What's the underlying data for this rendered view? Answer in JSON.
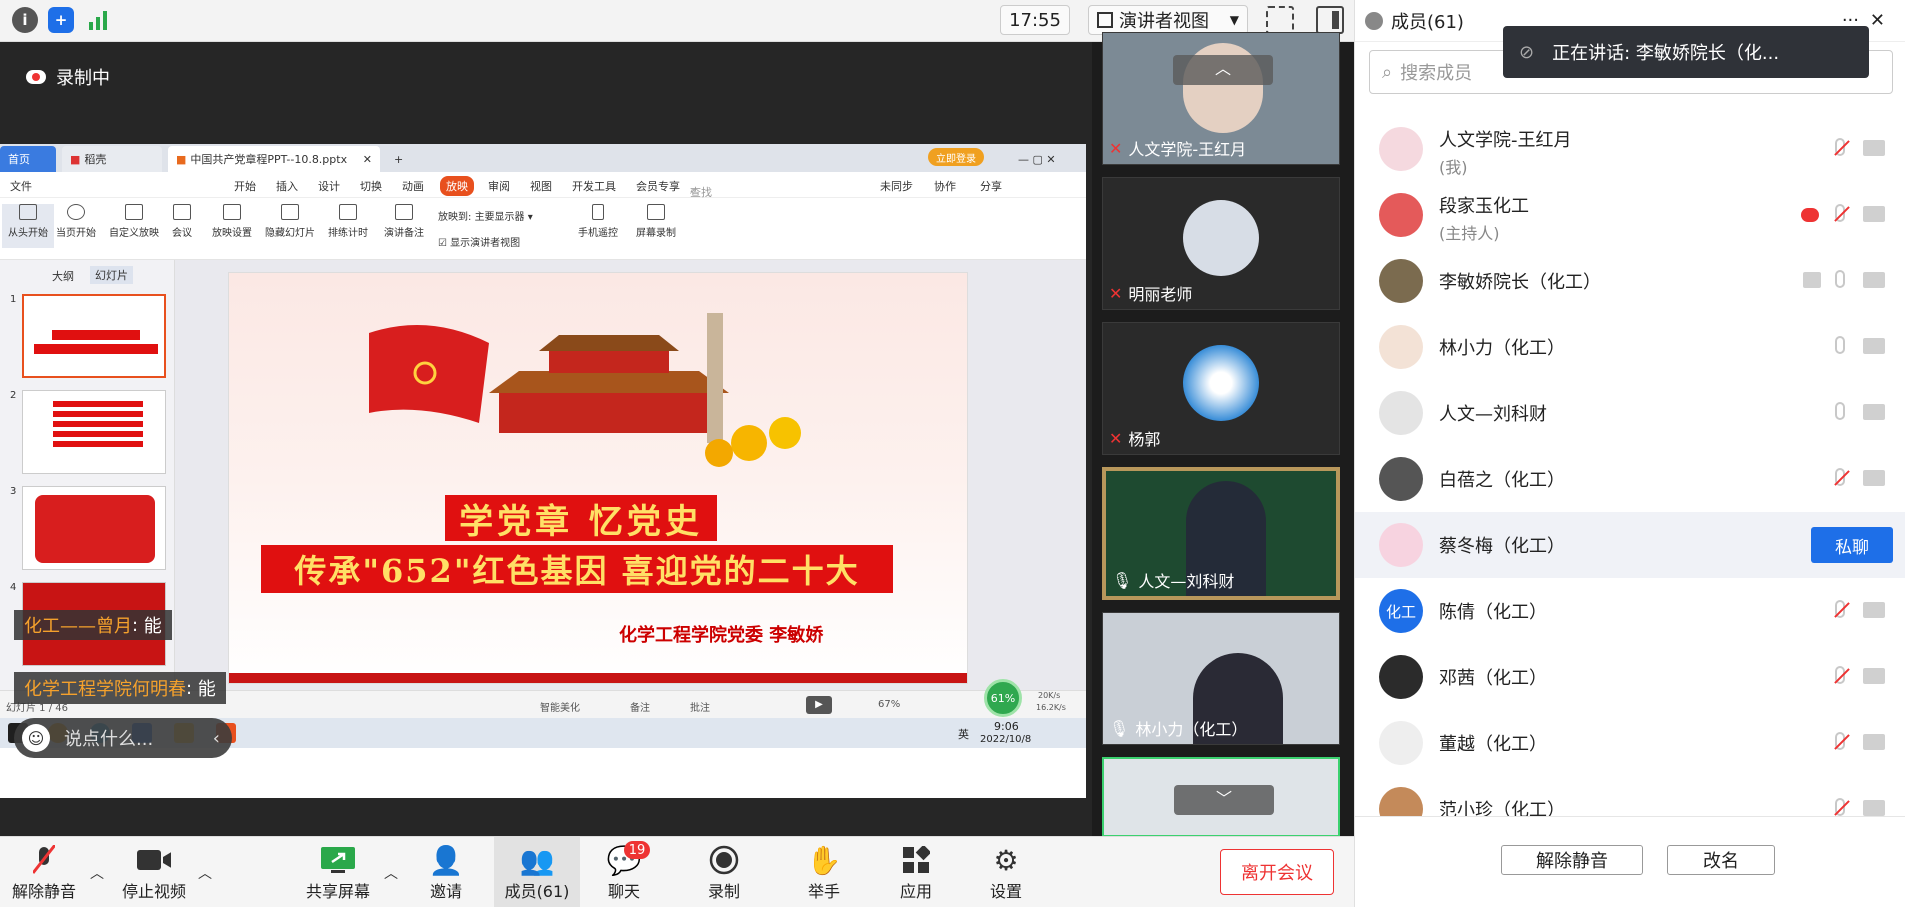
{
  "topbar": {
    "clock": "17:55",
    "view_mode": "演讲者视图"
  },
  "share": {
    "recording": "录制中",
    "wps": {
      "tabs": [
        "首页",
        "稻壳",
        "中国共产党章程PPT--10.8.pptx"
      ],
      "login": "立即登录",
      "menu": [
        "文件",
        "开始",
        "插入",
        "设计",
        "切换",
        "动画",
        "放映",
        "审阅",
        "视图",
        "开发工具",
        "会员专享"
      ],
      "search": "查找命令、搜索模板",
      "right_menu": [
        "未同步",
        "协作",
        "分享"
      ],
      "ribbon": [
        "从头开始",
        "当页开始",
        "自定义放映",
        "会议",
        "放映设置",
        "隐藏幻灯片",
        "排练计时",
        "演讲备注",
        "手机遥控",
        "屏幕录制"
      ],
      "display_label": "放映到:",
      "display_value": "主要显示器",
      "presenter_view": "显示演讲者视图",
      "pane_tabs": [
        "大纲",
        "幻灯片"
      ],
      "thumb_numbers": [
        "1",
        "2",
        "3",
        "4"
      ],
      "slide_title1": "学党章  忆党史",
      "slide_title2": "传承\"652\"红色基因  喜迎党的二十大",
      "slide_author": "化学工程学院党委  李敏娇",
      "status_left": "幻灯片 1 / 46",
      "status_right": [
        "智能美化",
        "备注",
        "批注"
      ],
      "zoom": "67%",
      "net_percent": "61%",
      "net_up": "20K/s",
      "net_down": "16.2K/s",
      "task_time": "9:06",
      "task_date": "2022/10/8",
      "task_lang": "英"
    },
    "chat_preview": [
      {
        "from": "化工——曾月",
        "text": "能"
      },
      {
        "from": "化学工程学院何明春",
        "text": "能"
      }
    ],
    "chat_input_placeholder": "说点什么..."
  },
  "video_tiles": [
    "人文学院-王红月",
    "明丽老师",
    "杨郭",
    "人文—刘科财",
    "林小力（化工）"
  ],
  "members_panel": {
    "title": "成员(61)",
    "search_placeholder": "搜索成员",
    "speaking": "正在讲话: 李敏娇院长（化...",
    "members": [
      {
        "name": "人文学院-王红月",
        "sub": "(我)"
      },
      {
        "name": "段家玉化工",
        "sub": "(主持人)"
      },
      {
        "name": "李敏娇院长（化工）",
        "sub": ""
      },
      {
        "name": "林小力（化工）",
        "sub": ""
      },
      {
        "name": "人文—刘科财",
        "sub": ""
      },
      {
        "name": "白蓓之（化工）",
        "sub": ""
      },
      {
        "name": "蔡冬梅（化工）",
        "sub": ""
      },
      {
        "name": "陈倩（化工）",
        "sub": ""
      },
      {
        "name": "邓茜（化工）",
        "sub": ""
      },
      {
        "name": "董越（化工）",
        "sub": ""
      },
      {
        "name": "范小珍（化工）",
        "sub": ""
      }
    ],
    "avatar_text": "化工",
    "private_chat": "私聊",
    "unmute_all": "解除静音",
    "rename": "改名"
  },
  "toolbar": {
    "unmute": "解除静音",
    "stop_video": "停止视频",
    "share_screen": "共享屏幕",
    "invite": "邀请",
    "members": "成员(61)",
    "chat": "聊天",
    "chat_badge": "19",
    "record": "录制",
    "raise_hand": "举手",
    "apps": "应用",
    "settings": "设置",
    "leave": "离开会议"
  }
}
